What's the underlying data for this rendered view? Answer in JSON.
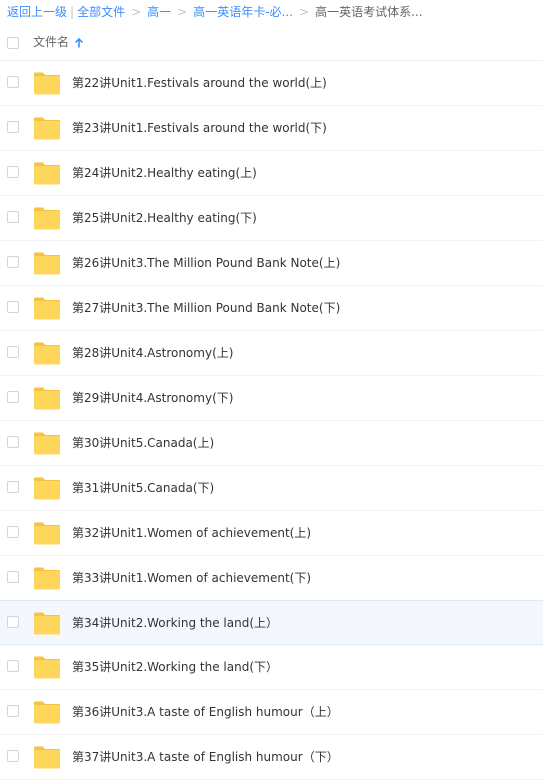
{
  "breadcrumb": {
    "back": "返回上一级",
    "separator_bar": "|",
    "all_files": "全部文件",
    "arrow": ">",
    "level1": "高一",
    "level2": "高一英语年卡-必...",
    "current": "高一英语考试体系..."
  },
  "header": {
    "name_column": "文件名",
    "sort_direction": "ascending"
  },
  "colors": {
    "link": "#3b8cff",
    "folder": "#ffd65c",
    "folder_tab": "#f5c242",
    "selected_row_bg": "#f4f8fe"
  },
  "files": [
    {
      "name": "第22讲Unit1.Festivals around the world(上)",
      "type": "folder-icon"
    },
    {
      "name": "第23讲Unit1.Festivals around the world(下)",
      "type": "folder-icon"
    },
    {
      "name": "第24讲Unit2.Healthy eating(上)",
      "type": "folder-icon"
    },
    {
      "name": "第25讲Unit2.Healthy eating(下)",
      "type": "folder-icon"
    },
    {
      "name": "第26讲Unit3.The Million Pound Bank Note(上)",
      "type": "folder-icon"
    },
    {
      "name": "第27讲Unit3.The Million Pound Bank Note(下)",
      "type": "folder-icon"
    },
    {
      "name": "第28讲Unit4.Astronomy(上)",
      "type": "folder-icon"
    },
    {
      "name": "第29讲Unit4.Astronomy(下)",
      "type": "folder-icon"
    },
    {
      "name": "第30讲Unit5.Canada(上)",
      "type": "folder-icon"
    },
    {
      "name": "第31讲Unit5.Canada(下)",
      "type": "folder-icon"
    },
    {
      "name": "第32讲Unit1.Women of achievement(上)",
      "type": "folder-icon"
    },
    {
      "name": "第33讲Unit1.Women of achievement(下)",
      "type": "folder-icon"
    },
    {
      "name": "第34讲Unit2.Working the land(上）",
      "type": "folder-icon",
      "hovered": true
    },
    {
      "name": "第35讲Unit2.Working the land(下）",
      "type": "folder-icon"
    },
    {
      "name": "第36讲Unit3.A taste of English humour（上）",
      "type": "folder-icon"
    },
    {
      "name": "第37讲Unit3.A taste of English humour（下）",
      "type": "folder-icon"
    }
  ]
}
